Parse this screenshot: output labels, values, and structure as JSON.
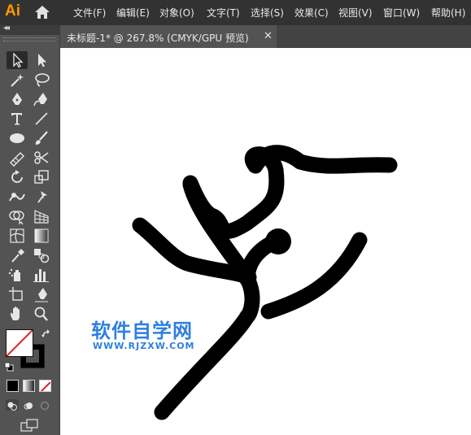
{
  "app": {
    "logo": "Ai"
  },
  "menu": [
    "文件(F)",
    "编辑(E)",
    "对象(O)",
    "文字(T)",
    "选择(S)",
    "效果(C)",
    "视图(V)",
    "窗口(W)",
    "帮助(H)"
  ],
  "document": {
    "tab_title": "未标题-1* @ 267.8% (CMYK/GPU 预览)",
    "close_label": "✕"
  },
  "toolbar": {
    "collapse_label": "◂◂"
  },
  "watermark": {
    "chinese": "软件自学网",
    "url": "WWW.RJZXW.COM"
  },
  "colors": {
    "fill": "#FFFFFF",
    "stroke": "#000000",
    "accent_logo": "#FF9A00",
    "watermark": "#2E7FE0"
  },
  "tools": [
    "selection-tool-icon",
    "direct-selection-tool-icon",
    "magic-wand-tool-icon",
    "lasso-tool-icon",
    "pen-tool-icon",
    "curvature-tool-icon",
    "type-tool-icon",
    "line-segment-tool-icon",
    "ellipse-tool-icon",
    "paintbrush-tool-icon",
    "shaper-tool-icon",
    "scissors-tool-icon",
    "rotate-tool-icon",
    "scale-tool-icon",
    "warp-tool-icon",
    "puppet-warp-tool-icon",
    "shape-builder-tool-icon",
    "perspective-grid-tool-icon",
    "mesh-tool-icon",
    "gradient-tool-icon",
    "eyedropper-tool-icon",
    "blend-tool-icon",
    "symbol-sprayer-tool-icon",
    "column-graph-tool-icon",
    "artboard-tool-icon",
    "slice-tool-icon",
    "hand-tool-icon",
    "zoom-tool-icon"
  ]
}
